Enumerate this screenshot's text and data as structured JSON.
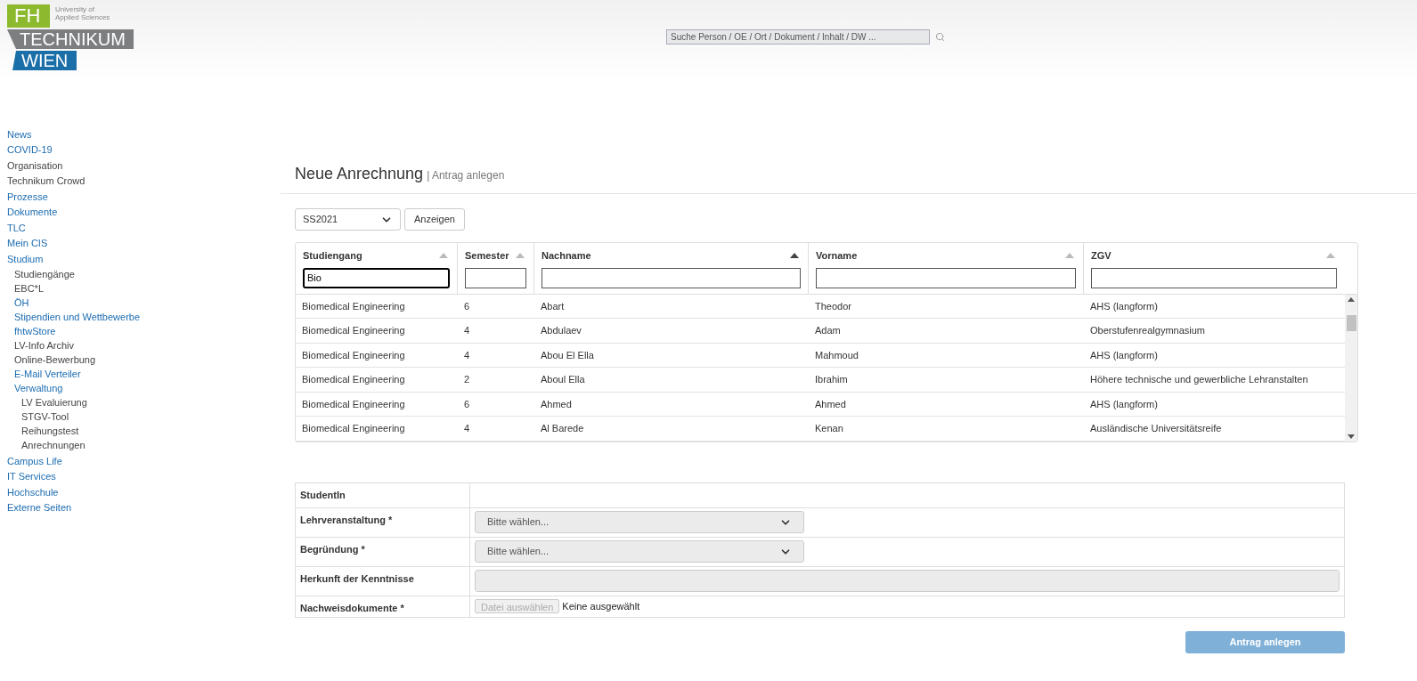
{
  "logo": {
    "mark": "FH",
    "tagline": [
      "University of",
      "Applied Sciences"
    ],
    "name": "TECHNIKUM",
    "city": "WIEN"
  },
  "search": {
    "placeholder": "Suche Person / OE / Ort / Dokument / Inhalt / DW ..."
  },
  "sidebar": {
    "items": [
      {
        "label": "News",
        "kind": "link"
      },
      {
        "label": "COVID-19",
        "kind": "link"
      },
      {
        "label": "Organisation",
        "kind": "plain"
      },
      {
        "label": "Technikum Crowd",
        "kind": "plain"
      },
      {
        "label": "Prozesse",
        "kind": "link"
      },
      {
        "label": "Dokumente",
        "kind": "link"
      },
      {
        "label": "TLC",
        "kind": "link"
      },
      {
        "label": "Mein CIS",
        "kind": "link"
      },
      {
        "label": "Studium",
        "kind": "link",
        "children": [
          {
            "label": "Studiengänge",
            "kind": "plain"
          },
          {
            "label": "EBC*L",
            "kind": "plain"
          },
          {
            "label": "ÖH",
            "kind": "link"
          },
          {
            "label": "Stipendien und Wettbewerbe",
            "kind": "link"
          },
          {
            "label": "fhtwStore",
            "kind": "link"
          },
          {
            "label": "LV-Info Archiv",
            "kind": "plain"
          },
          {
            "label": "Online-Bewerbung",
            "kind": "plain"
          },
          {
            "label": "E-Mail Verteiler",
            "kind": "link"
          },
          {
            "label": "Verwaltung",
            "kind": "link",
            "children": [
              {
                "label": "LV Evaluierung",
                "kind": "plain"
              },
              {
                "label": "STGV-Tool",
                "kind": "plain"
              },
              {
                "label": "Reihungstest",
                "kind": "plain"
              },
              {
                "label": "Anrechnungen",
                "kind": "plain"
              }
            ]
          }
        ]
      },
      {
        "label": "Campus Life",
        "kind": "link"
      },
      {
        "label": "IT Services",
        "kind": "link"
      },
      {
        "label": "Hochschule",
        "kind": "link"
      },
      {
        "label": "Externe Seiten",
        "kind": "link"
      }
    ]
  },
  "page": {
    "title": "Neue Anrechnung",
    "subtitle": "| Antrag anlegen"
  },
  "semester_select": {
    "value": "SS2021"
  },
  "show_button": "Anzeigen",
  "table": {
    "columns": [
      {
        "label": "Studiengang",
        "sorted": false,
        "filter": "Bio",
        "focused": true
      },
      {
        "label": "Semester",
        "sorted": false,
        "focused": false
      },
      {
        "label": "Nachname",
        "sorted": true,
        "focused": false
      },
      {
        "label": "Vorname",
        "sorted": false,
        "focused": false
      },
      {
        "label": "ZGV",
        "sorted": false,
        "focused": false
      }
    ],
    "rows": [
      [
        "Biomedical Engineering",
        "6",
        "Abart",
        "Theodor",
        "AHS (langform)"
      ],
      [
        "Biomedical Engineering",
        "4",
        "Abdulaev",
        "Adam",
        "Oberstufenrealgymnasium"
      ],
      [
        "Biomedical Engineering",
        "4",
        "Abou El Ella",
        "Mahmoud",
        "AHS (langform)"
      ],
      [
        "Biomedical Engineering",
        "2",
        "Aboul Ella",
        "Ibrahim",
        "Höhere technische und gewerbliche Lehranstalten"
      ],
      [
        "Biomedical Engineering",
        "6",
        "Ahmed",
        "Ahmed",
        "AHS (langform)"
      ],
      [
        "Biomedical Engineering",
        "4",
        "Al Barede",
        "Kenan",
        "Ausländische Universitätsreife"
      ]
    ]
  },
  "form": {
    "rows": [
      {
        "label": "StudentIn",
        "kind": "empty"
      },
      {
        "label": "Lehrveranstaltung *",
        "kind": "select",
        "placeholder": "Bitte wählen..."
      },
      {
        "label": "Begründung *",
        "kind": "select",
        "placeholder": "Bitte wählen..."
      },
      {
        "label": "Herkunft der Kenntnisse",
        "kind": "textarea"
      },
      {
        "label": "Nachweisdokumente *",
        "kind": "file",
        "button": "Datei auswählen",
        "status": "Keine ausgewählt"
      }
    ]
  },
  "submit": {
    "label": "Antrag anlegen",
    "disabled": true
  }
}
